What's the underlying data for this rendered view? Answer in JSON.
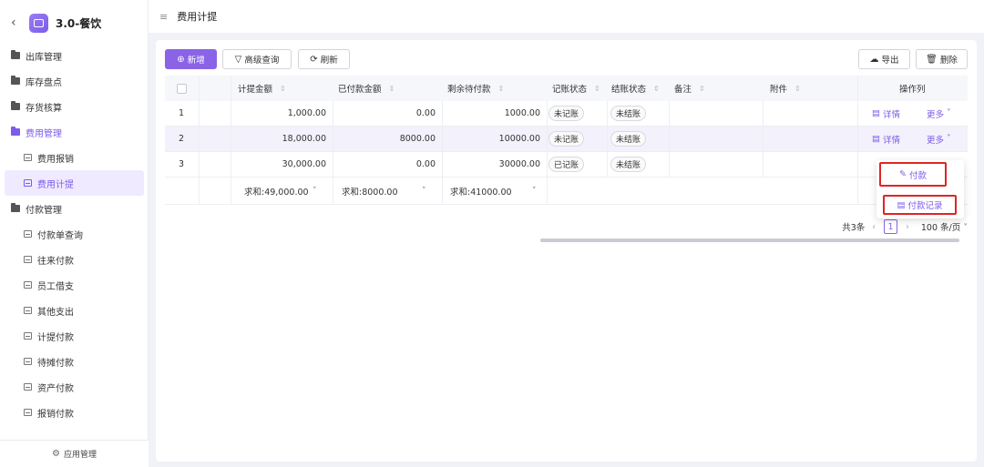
{
  "app": {
    "title": "3.0-餐饮"
  },
  "sidebar": {
    "items": [
      {
        "label": "出库管理",
        "type": "group"
      },
      {
        "label": "库存盘点",
        "type": "group"
      },
      {
        "label": "存货核算",
        "type": "group"
      },
      {
        "label": "费用管理",
        "type": "group-open"
      },
      {
        "label": "费用报销",
        "type": "sub"
      },
      {
        "label": "费用计提",
        "type": "sub-active"
      },
      {
        "label": "付款管理",
        "type": "group"
      },
      {
        "label": "付款单查询",
        "type": "sub"
      },
      {
        "label": "往来付款",
        "type": "sub"
      },
      {
        "label": "员工借支",
        "type": "sub"
      },
      {
        "label": "其他支出",
        "type": "sub"
      },
      {
        "label": "计提付款",
        "type": "sub"
      },
      {
        "label": "待摊付款",
        "type": "sub"
      },
      {
        "label": "资产付款",
        "type": "sub"
      },
      {
        "label": "报销付款",
        "type": "sub"
      }
    ],
    "footer": "应用管理"
  },
  "topbar": {
    "title": "费用计提"
  },
  "toolbar": {
    "add": "新增",
    "advanced_search": "高级查询",
    "refresh": "刷新",
    "export": "导出",
    "delete": "删除"
  },
  "table": {
    "columns": {
      "accrued": "计提金额",
      "paid": "已付款金额",
      "remaining": "剩余待付款",
      "booking_status": "记账状态",
      "closing_status": "结账状态",
      "remark": "备注",
      "attachment": "附件",
      "actions": "操作列"
    },
    "rows": [
      {
        "index": "1",
        "accrued": "1,000.00",
        "paid": "0.00",
        "remaining": "1000.00",
        "booking": "未记账",
        "closing": "未结账",
        "detail": "详情",
        "more": "更多"
      },
      {
        "index": "2",
        "accrued": "18,000.00",
        "paid": "8000.00",
        "remaining": "10000.00",
        "booking": "未记账",
        "closing": "未结账",
        "detail": "详情",
        "more": "更多"
      },
      {
        "index": "3",
        "accrued": "30,000.00",
        "paid": "0.00",
        "remaining": "30000.00",
        "booking": "已记账",
        "closing": "未结账"
      }
    ],
    "summary": {
      "accrued": "求和:49,000.00",
      "paid": "求和:8000.00",
      "remaining": "求和:41000.00"
    }
  },
  "dropdown": {
    "pay": "付款",
    "pay_record": "付款记录"
  },
  "pager": {
    "total": "共3条",
    "page": "1",
    "page_size": "100 条/页"
  },
  "colors": {
    "accent": "#8a63e6",
    "highlight_border": "#e02424"
  }
}
